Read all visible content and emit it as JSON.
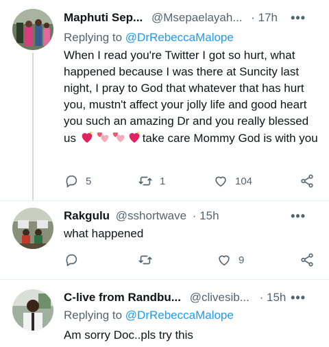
{
  "tweets": [
    {
      "name": "Maphuti Sep...",
      "handle": "@Msepaelayah...",
      "time": "· 17h",
      "replying_prefix": "Replying to ",
      "replying_to": "@DrRebeccaMalope",
      "text_part1": "When I read you're Twitter I got so hurt, what happened because I was there at Suncity last night, I pray to God that whatever that has hurt you, mustn't affect your jolly life and good heart you such an amazing Dr and you really blessed us ",
      "text_part2": "take care Mommy God is with you",
      "emojis": [
        "sparkling-heart-emoji",
        "revolving-hearts-emoji",
        "revolving-hearts-emoji",
        "sparkling-heart-emoji"
      ],
      "replies": "5",
      "retweets": "1",
      "likes": "104"
    },
    {
      "name": "Rakgulu",
      "handle": "@sshortwave",
      "time": "· 15h",
      "text": "what happened",
      "replies": "",
      "retweets": "",
      "likes": "9"
    },
    {
      "name": "C-live from Randbu...",
      "handle": "@clivesib...",
      "time": "· 15h",
      "replying_prefix": "Replying to ",
      "replying_to": "@DrRebeccaMalope",
      "text": "Am sorry Doc..pls try this"
    }
  ],
  "icons": {
    "reply": "reply-icon",
    "retweet": "retweet-icon",
    "like": "heart-icon",
    "share": "share-icon",
    "more": "more-icon"
  },
  "colors": {
    "accent": "#1d9bf0",
    "secondary_text": "#536471",
    "divider": "#e6ecf0"
  },
  "more_glyph": "•••"
}
